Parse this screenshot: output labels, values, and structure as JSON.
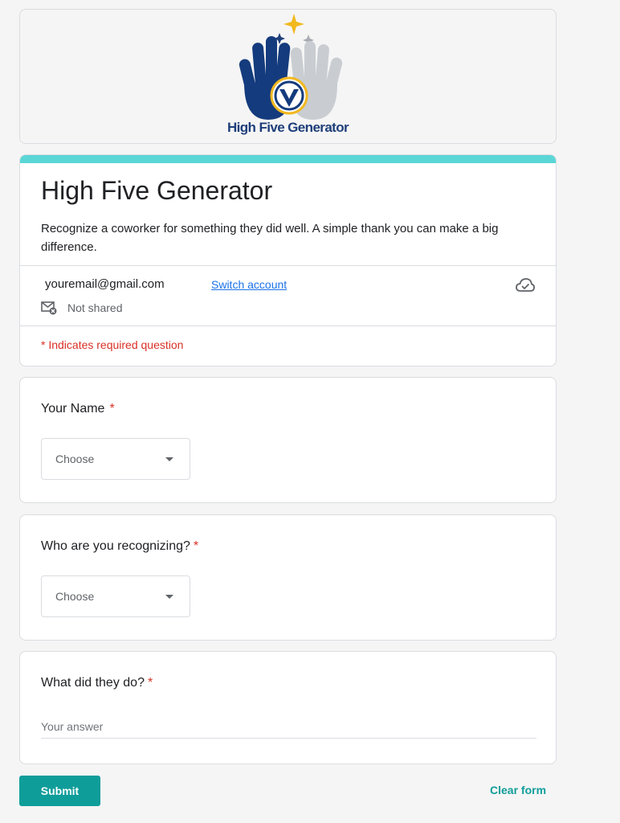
{
  "banner": {
    "logo_text": "High Five Generator"
  },
  "form": {
    "title": "High Five Generator",
    "description": "Recognize a coworker for something they did well. A simple thank you can make a big difference.",
    "accent_color": "#5bd6d6"
  },
  "account": {
    "email": "youremail@gmail.com",
    "switch_label": "Switch account",
    "shared_status": "Not shared",
    "cloud_icon": "cloud-check-icon",
    "mail_icon": "mail-blocked-icon"
  },
  "required_note": "* Indicates required question",
  "questions": [
    {
      "title": "Your Name",
      "required_mark": "*",
      "type": "dropdown",
      "selected": "Choose"
    },
    {
      "title": "Who are you recognizing?",
      "required_mark": "*",
      "type": "dropdown",
      "selected": "Choose"
    },
    {
      "title": "What did they do?",
      "required_mark": "*",
      "type": "text",
      "placeholder": "Your answer"
    }
  ],
  "actions": {
    "submit_label": "Submit",
    "clear_label": "Clear form",
    "primary_color": "#0f9d9a"
  }
}
